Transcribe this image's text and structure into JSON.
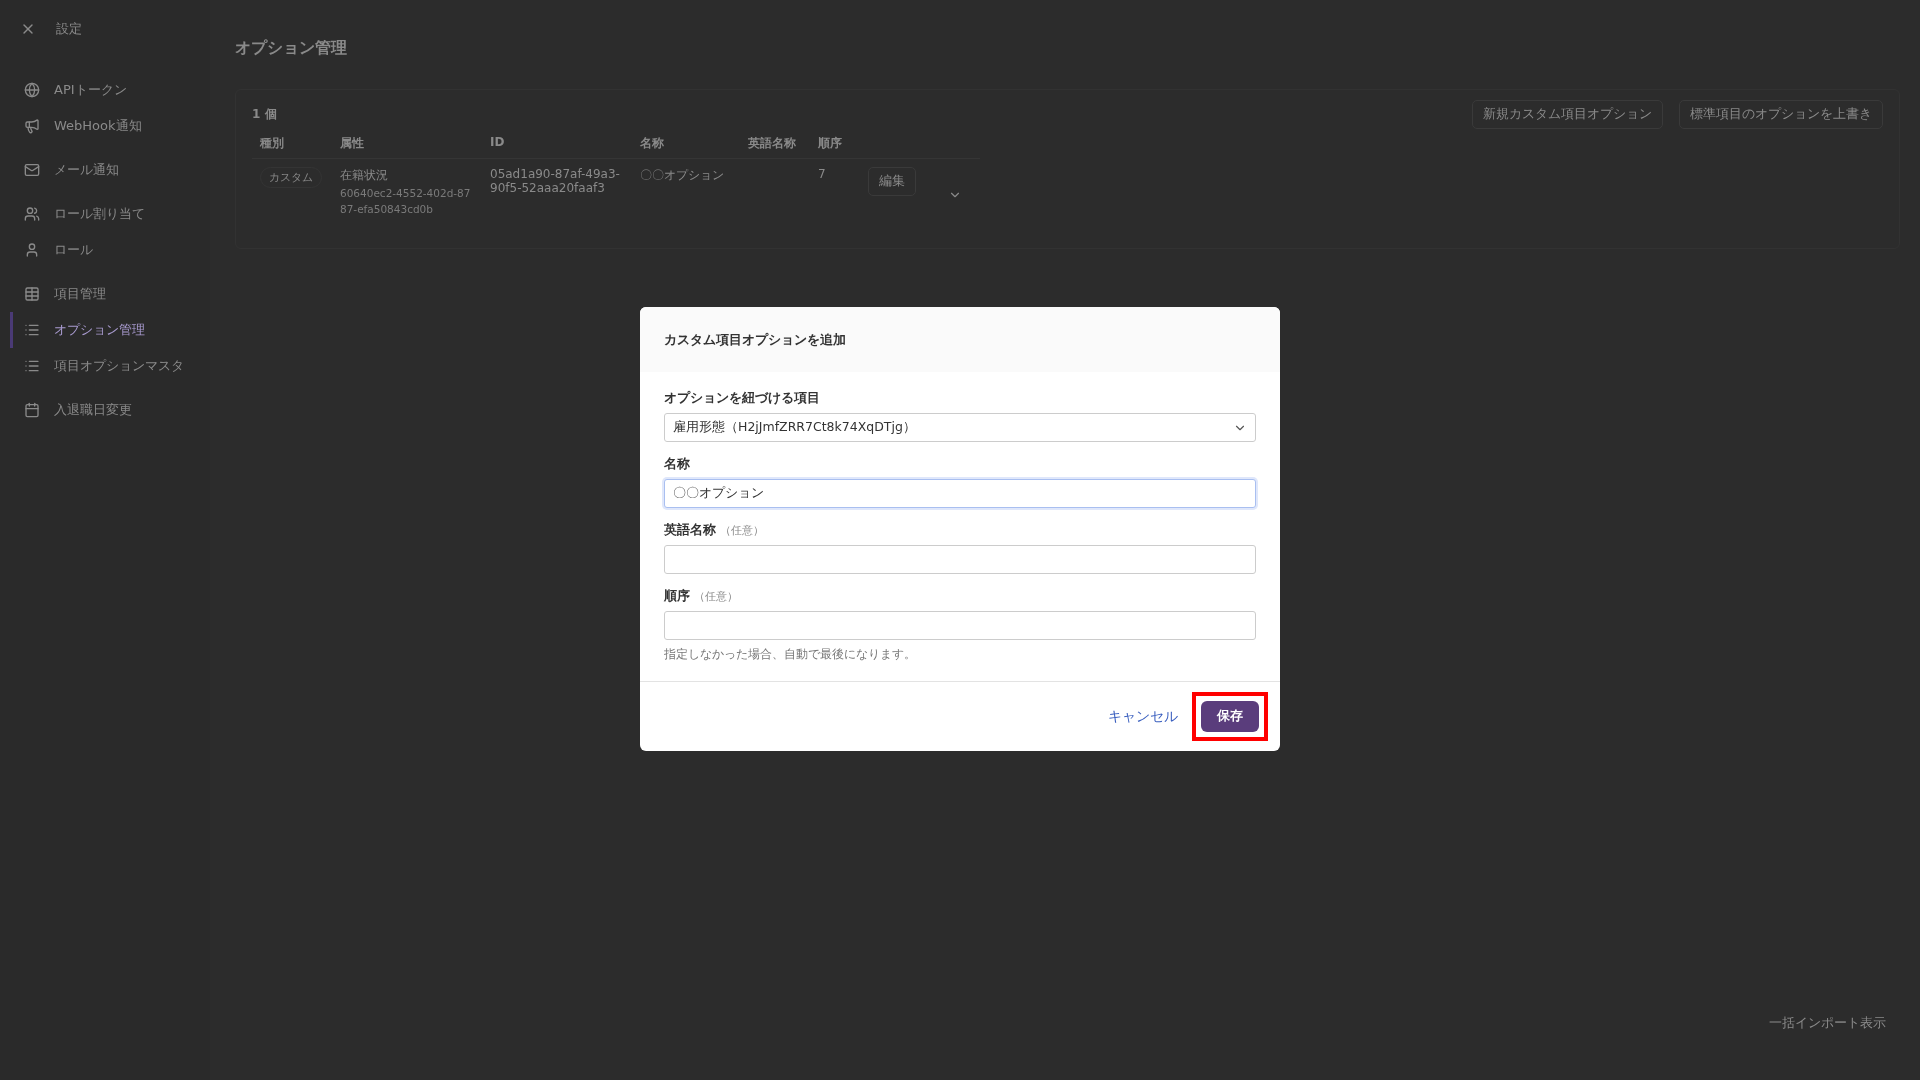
{
  "sidebar": {
    "title": "設定",
    "items": [
      {
        "label": "APIトークン",
        "selected": false
      },
      {
        "label": "WebHook通知",
        "selected": false
      },
      {
        "label": "メール通知",
        "selected": false
      },
      {
        "label": "ロール割り当て",
        "selected": false
      },
      {
        "label": "ロール",
        "selected": false
      },
      {
        "label": "項目管理",
        "selected": false
      },
      {
        "label": "オプション管理",
        "selected": true
      },
      {
        "label": "項目オプションマスタ",
        "selected": false
      },
      {
        "label": "入退職日変更",
        "selected": false
      }
    ]
  },
  "page": {
    "title": "オプション管理",
    "count": "1 個",
    "buttons": [
      "新規カスタム項目オプション",
      "標準項目のオプションを上書き"
    ],
    "footer_link": "一括インポート表示"
  },
  "table": {
    "columns": [
      "種別",
      "属性",
      "ID",
      "名称",
      "英語名称",
      "順序"
    ],
    "rows": [
      {
        "type": "カスタム",
        "attribute": "在籍状況",
        "attribute_id": "60640ec2-4552-402d-8787-efa50843cd0b",
        "id": "05ad1a90-87af-49a3-90f5-52aaa20faaf3",
        "name": "〇〇オプション",
        "order": "7",
        "edit": "編集"
      }
    ]
  },
  "dialog": {
    "title": "カスタム項目オプションを追加",
    "fields": [
      {
        "kind": "select",
        "label": "オプションを紐づける項目",
        "value": "雇用形態（H2jJmfZRR7Ct8k74XqDTjg）",
        "focused": false
      },
      {
        "kind": "text",
        "label": "名称",
        "value": "〇〇オプション",
        "focused": true
      },
      {
        "kind": "text",
        "label": "英語名称",
        "optional": "（任意）",
        "focused": false
      },
      {
        "kind": "text",
        "label": "順序",
        "optional": "（任意）",
        "focused": false,
        "help": "指定しなかった場合、自動で最後になります。"
      }
    ],
    "cancel": "キャンセル",
    "save": "保存",
    "save_highlighted": true
  }
}
